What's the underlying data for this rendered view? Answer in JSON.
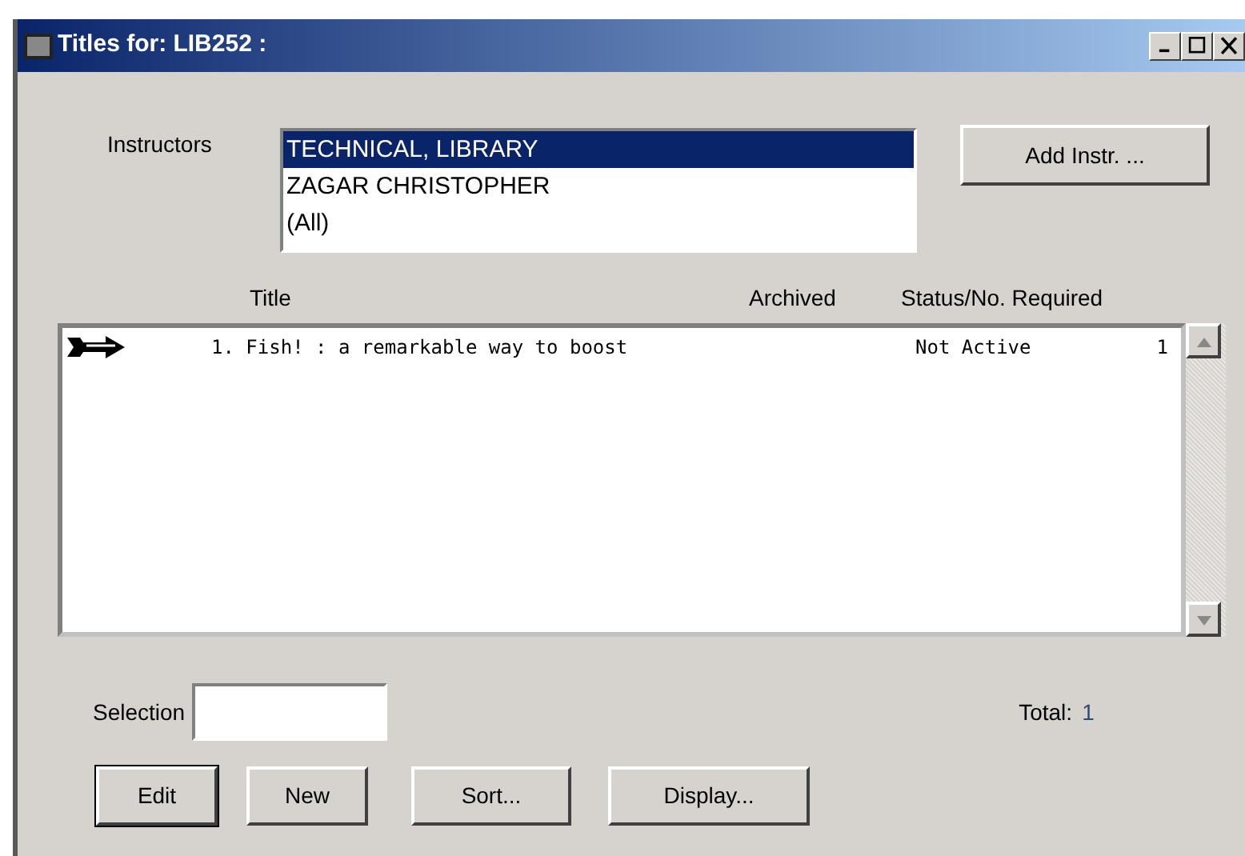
{
  "window": {
    "title": "Titles for: LIB252 :"
  },
  "instructors": {
    "label": "Instructors",
    "items": [
      {
        "name": "TECHNICAL, LIBRARY",
        "selected": true
      },
      {
        "name": "ZAGAR CHRISTOPHER",
        "selected": false
      },
      {
        "name": "(All)",
        "selected": false
      }
    ],
    "add_button": "Add Instr. ..."
  },
  "table": {
    "columns": [
      "Title",
      "Archived",
      "Status/No. Required"
    ],
    "rows": [
      {
        "current": true,
        "title": "1. Fish! : a remarkable way to boost",
        "status": "Not Active",
        "required": "1"
      }
    ]
  },
  "selection": {
    "label": "Selection"
  },
  "total": {
    "label": "Total:",
    "value": "1"
  },
  "buttons": [
    {
      "label": "Edit",
      "default": true
    },
    {
      "label": "New",
      "default": false
    },
    {
      "label": "Sort...",
      "default": false
    },
    {
      "label": "Display...",
      "default": false
    }
  ]
}
